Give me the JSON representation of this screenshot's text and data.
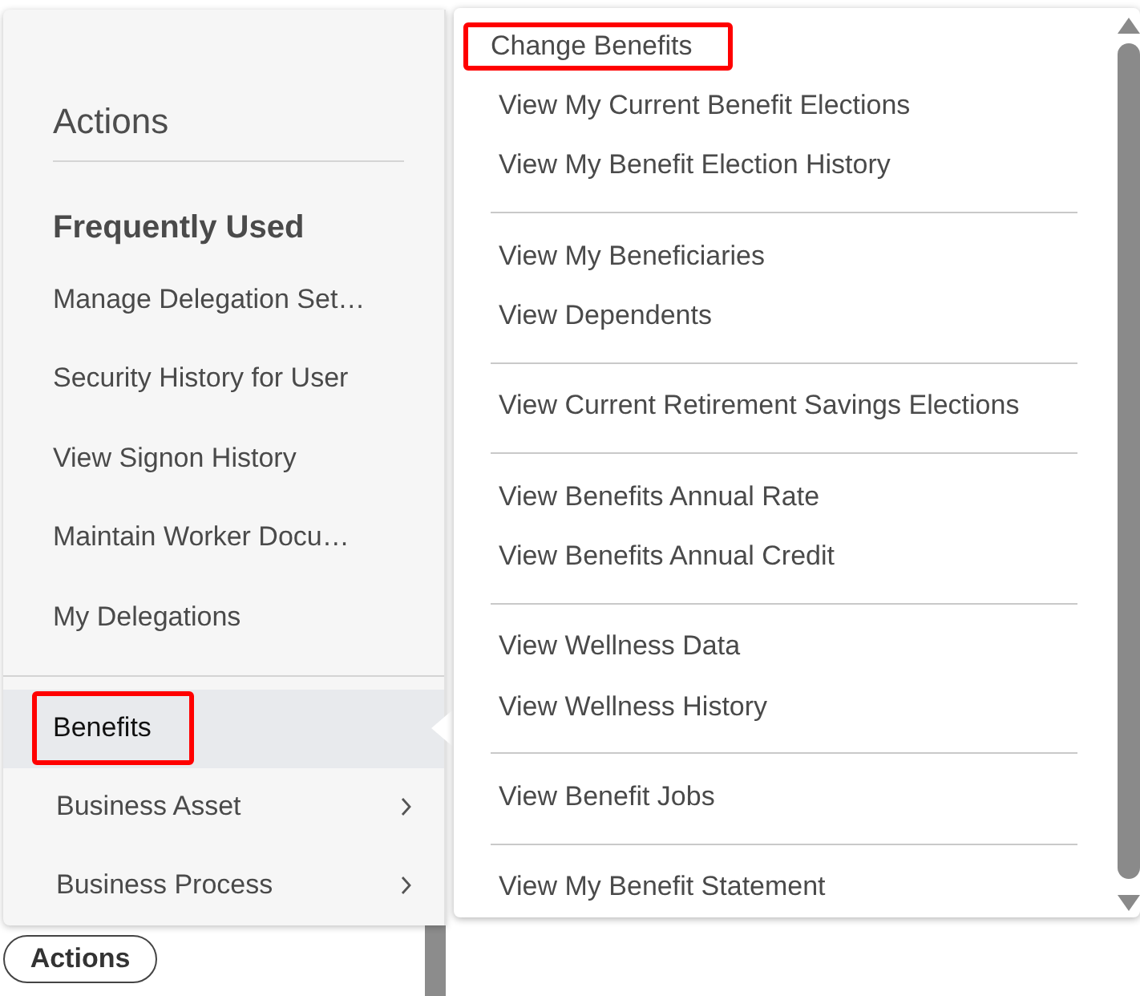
{
  "panel_title": "Actions",
  "section_heading": "Frequently Used",
  "frequent_items": [
    "Manage Delegation Set…",
    "Security History for User",
    "View Signon History",
    "Maintain Worker Docu…",
    "My Delegations"
  ],
  "categories": [
    {
      "label": "Benefits",
      "selected": true,
      "has_submenu": false,
      "annotated": true
    },
    {
      "label": "Business Asset",
      "selected": false,
      "has_submenu": true,
      "annotated": false
    },
    {
      "label": "Business Process",
      "selected": false,
      "has_submenu": true,
      "annotated": false
    }
  ],
  "submenu": {
    "groups": [
      {
        "items": [
          {
            "label": "Change Benefits",
            "annotated": true
          },
          {
            "label": "View My Current Benefit Elections",
            "annotated": false
          },
          {
            "label": "View My Benefit Election History",
            "annotated": false
          }
        ]
      },
      {
        "items": [
          {
            "label": "View My Beneficiaries",
            "annotated": false
          },
          {
            "label": "View Dependents",
            "annotated": false
          }
        ]
      },
      {
        "items": [
          {
            "label": "View Current Retirement Savings Elections",
            "annotated": false
          }
        ]
      },
      {
        "items": [
          {
            "label": "View Benefits Annual Rate",
            "annotated": false
          },
          {
            "label": "View Benefits Annual Credit",
            "annotated": false
          }
        ]
      },
      {
        "items": [
          {
            "label": "View Wellness Data",
            "annotated": false
          },
          {
            "label": "View Wellness History",
            "annotated": false
          }
        ]
      },
      {
        "items": [
          {
            "label": "View Benefit Jobs",
            "annotated": false
          }
        ]
      },
      {
        "items": [
          {
            "label": "View My Benefit Statement",
            "annotated": false
          }
        ]
      }
    ]
  },
  "actions_button": {
    "label": "Actions"
  }
}
